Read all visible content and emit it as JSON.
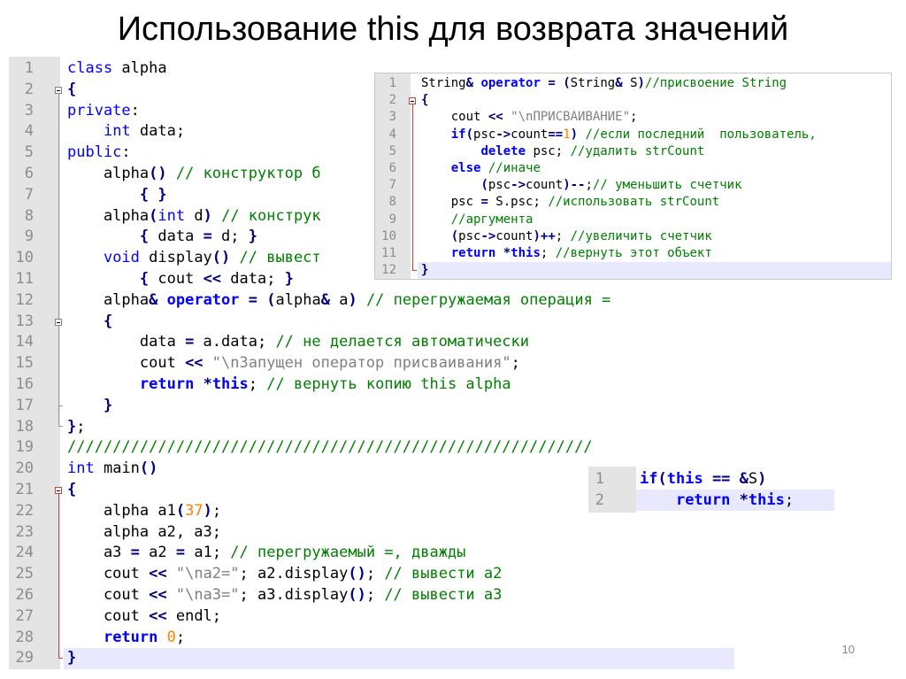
{
  "slide": {
    "title": "Использование this для возврата значений",
    "page_number": "10"
  },
  "colors": {
    "keyword": "#0000ff",
    "comment": "#008000",
    "string": "#808080",
    "number": "#ff8000",
    "gutter": "#e4e4e4",
    "current_line": "#e8e8ff"
  },
  "main_code": {
    "lines": [
      {
        "n": "1",
        "t": [
          [
            "kw",
            "class"
          ],
          [
            "pl",
            " alpha"
          ]
        ]
      },
      {
        "n": "2",
        "t": [
          [
            "op",
            "{"
          ]
        ]
      },
      {
        "n": "3",
        "t": [
          [
            "kw",
            "private"
          ],
          [
            "pl",
            ":"
          ]
        ]
      },
      {
        "n": "4",
        "t": [
          [
            "pl",
            "    "
          ],
          [
            "kw",
            "int"
          ],
          [
            "pl",
            " data;"
          ]
        ]
      },
      {
        "n": "5",
        "t": [
          [
            "kw",
            "public"
          ],
          [
            "pl",
            ":"
          ]
        ]
      },
      {
        "n": "6",
        "t": [
          [
            "pl",
            "    alpha"
          ],
          [
            "op",
            "()"
          ],
          [
            "pl",
            " "
          ],
          [
            "cm",
            "// конструктор б"
          ]
        ]
      },
      {
        "n": "7",
        "t": [
          [
            "pl",
            "        "
          ],
          [
            "op",
            "{"
          ],
          [
            "pl",
            " "
          ],
          [
            "op",
            "}"
          ]
        ]
      },
      {
        "n": "8",
        "t": [
          [
            "pl",
            "    alpha"
          ],
          [
            "op",
            "("
          ],
          [
            "kw",
            "int"
          ],
          [
            "pl",
            " d"
          ],
          [
            "op",
            ")"
          ],
          [
            "pl",
            " "
          ],
          [
            "cm",
            "// конструк"
          ]
        ]
      },
      {
        "n": "9",
        "t": [
          [
            "pl",
            "        "
          ],
          [
            "op",
            "{"
          ],
          [
            "pl",
            " data "
          ],
          [
            "op",
            "="
          ],
          [
            "pl",
            " d; "
          ],
          [
            "op",
            "}"
          ]
        ]
      },
      {
        "n": "10",
        "t": [
          [
            "pl",
            "    "
          ],
          [
            "kw",
            "void"
          ],
          [
            "pl",
            " display"
          ],
          [
            "op",
            "()"
          ],
          [
            "pl",
            " "
          ],
          [
            "cm",
            "// вывест"
          ]
        ]
      },
      {
        "n": "11",
        "t": [
          [
            "pl",
            "        "
          ],
          [
            "op",
            "{"
          ],
          [
            "pl",
            " cout "
          ],
          [
            "op",
            "<<"
          ],
          [
            "pl",
            " data; "
          ],
          [
            "op",
            "}"
          ]
        ]
      },
      {
        "n": "12",
        "t": [
          [
            "pl",
            "    alpha"
          ],
          [
            "op",
            "&"
          ],
          [
            "pl",
            " "
          ],
          [
            "kwb",
            "operator"
          ],
          [
            "pl",
            " "
          ],
          [
            "op",
            "="
          ],
          [
            "pl",
            " "
          ],
          [
            "op",
            "("
          ],
          [
            "pl",
            "alpha"
          ],
          [
            "op",
            "&"
          ],
          [
            "pl",
            " a"
          ],
          [
            "op",
            ")"
          ],
          [
            "pl",
            " "
          ],
          [
            "cm",
            "// перегружаемая операция ="
          ]
        ]
      },
      {
        "n": "13",
        "t": [
          [
            "pl",
            "    "
          ],
          [
            "op",
            "{"
          ]
        ]
      },
      {
        "n": "14",
        "t": [
          [
            "pl",
            "        data "
          ],
          [
            "op",
            "="
          ],
          [
            "pl",
            " a.data; "
          ],
          [
            "cm",
            "// не делается автоматически"
          ]
        ]
      },
      {
        "n": "15",
        "t": [
          [
            "pl",
            "        cout "
          ],
          [
            "op",
            "<<"
          ],
          [
            "pl",
            " "
          ],
          [
            "str",
            "\"\\nЗапущен оператор присваивания\""
          ],
          [
            "pl",
            ";"
          ]
        ]
      },
      {
        "n": "16",
        "t": [
          [
            "pl",
            "        "
          ],
          [
            "kwb",
            "return"
          ],
          [
            "pl",
            " "
          ],
          [
            "op",
            "*"
          ],
          [
            "kwb",
            "this"
          ],
          [
            "pl",
            "; "
          ],
          [
            "cm",
            "// вернуть копию this alpha"
          ]
        ]
      },
      {
        "n": "17",
        "t": [
          [
            "pl",
            "    "
          ],
          [
            "op",
            "}"
          ]
        ]
      },
      {
        "n": "18",
        "t": [
          [
            "op",
            "}"
          ],
          [
            "pl",
            ";"
          ]
        ]
      },
      {
        "n": "19",
        "t": [
          [
            "cm",
            "//////////////////////////////////////////////////////////"
          ]
        ]
      },
      {
        "n": "20",
        "t": [
          [
            "kw",
            "int"
          ],
          [
            "pl",
            " main"
          ],
          [
            "op",
            "()"
          ]
        ]
      },
      {
        "n": "21",
        "t": [
          [
            "op",
            "{"
          ]
        ]
      },
      {
        "n": "22",
        "t": [
          [
            "pl",
            "    alpha a1"
          ],
          [
            "op",
            "("
          ],
          [
            "num",
            "37"
          ],
          [
            "op",
            ")"
          ],
          [
            "pl",
            ";"
          ]
        ]
      },
      {
        "n": "23",
        "t": [
          [
            "pl",
            "    alpha a2, a3;"
          ]
        ]
      },
      {
        "n": "24",
        "t": [
          [
            "pl",
            "    a3 "
          ],
          [
            "op",
            "="
          ],
          [
            "pl",
            " a2 "
          ],
          [
            "op",
            "="
          ],
          [
            "pl",
            " a1; "
          ],
          [
            "cm",
            "// перегружаемый =, дважды"
          ]
        ]
      },
      {
        "n": "25",
        "t": [
          [
            "pl",
            "    cout "
          ],
          [
            "op",
            "<<"
          ],
          [
            "pl",
            " "
          ],
          [
            "str",
            "\"\\na2=\""
          ],
          [
            "pl",
            "; a2.display"
          ],
          [
            "op",
            "()"
          ],
          [
            "pl",
            "; "
          ],
          [
            "cm",
            "// вывести a2"
          ]
        ]
      },
      {
        "n": "26",
        "t": [
          [
            "pl",
            "    cout "
          ],
          [
            "op",
            "<<"
          ],
          [
            "pl",
            " "
          ],
          [
            "str",
            "\"\\na3=\""
          ],
          [
            "pl",
            "; a3.display"
          ],
          [
            "op",
            "()"
          ],
          [
            "pl",
            "; "
          ],
          [
            "cm",
            "// вывести a3"
          ]
        ]
      },
      {
        "n": "27",
        "t": [
          [
            "pl",
            "    cout "
          ],
          [
            "op",
            "<<"
          ],
          [
            "pl",
            " endl;"
          ]
        ]
      },
      {
        "n": "28",
        "t": [
          [
            "pl",
            "    "
          ],
          [
            "kwb",
            "return"
          ],
          [
            "pl",
            " "
          ],
          [
            "num",
            "0"
          ],
          [
            "pl",
            ";"
          ]
        ]
      },
      {
        "n": "29",
        "t": [
          [
            "op",
            "}"
          ]
        ]
      }
    ]
  },
  "inset_code": {
    "lines": [
      {
        "n": "1",
        "t": [
          [
            "pl",
            "String"
          ],
          [
            "op",
            "&"
          ],
          [
            "pl",
            " "
          ],
          [
            "kwb",
            "operator"
          ],
          [
            "pl",
            " "
          ],
          [
            "op",
            "="
          ],
          [
            "pl",
            " "
          ],
          [
            "op",
            "("
          ],
          [
            "pl",
            "String"
          ],
          [
            "op",
            "&"
          ],
          [
            "pl",
            " S"
          ],
          [
            "op",
            ")"
          ],
          [
            "cm",
            "//присвоение String"
          ]
        ]
      },
      {
        "n": "2",
        "t": [
          [
            "op",
            "{"
          ]
        ]
      },
      {
        "n": "3",
        "t": [
          [
            "pl",
            "    cout "
          ],
          [
            "op",
            "<<"
          ],
          [
            "pl",
            " "
          ],
          [
            "str",
            "\"\\nПРИСВАИВАНИЕ\""
          ],
          [
            "pl",
            ";"
          ]
        ]
      },
      {
        "n": "4",
        "t": [
          [
            "pl",
            "    "
          ],
          [
            "kwb",
            "if"
          ],
          [
            "op",
            "("
          ],
          [
            "pl",
            "psc"
          ],
          [
            "op",
            "->"
          ],
          [
            "pl",
            "count"
          ],
          [
            "op",
            "=="
          ],
          [
            "num",
            "1"
          ],
          [
            "op",
            ")"
          ],
          [
            "pl",
            " "
          ],
          [
            "cm",
            "//если последний  пользователь,"
          ]
        ]
      },
      {
        "n": "5",
        "t": [
          [
            "pl",
            "        "
          ],
          [
            "kwb",
            "delete"
          ],
          [
            "pl",
            " psc; "
          ],
          [
            "cm",
            "//удалить strCount"
          ]
        ]
      },
      {
        "n": "6",
        "t": [
          [
            "pl",
            "    "
          ],
          [
            "kwb",
            "else"
          ],
          [
            "pl",
            " "
          ],
          [
            "cm",
            "//иначе"
          ]
        ]
      },
      {
        "n": "7",
        "t": [
          [
            "pl",
            "        "
          ],
          [
            "op",
            "("
          ],
          [
            "pl",
            "psc"
          ],
          [
            "op",
            "->"
          ],
          [
            "pl",
            "count"
          ],
          [
            "op",
            ")--"
          ],
          [
            "pl",
            ";"
          ],
          [
            "cm",
            "// уменьшить счетчик"
          ]
        ]
      },
      {
        "n": "8",
        "t": [
          [
            "pl",
            "    psc "
          ],
          [
            "op",
            "="
          ],
          [
            "pl",
            " S.psc; "
          ],
          [
            "cm",
            "//использовать strCount"
          ]
        ]
      },
      {
        "n": "9",
        "t": [
          [
            "pl",
            "    "
          ],
          [
            "cm",
            "//аргумента"
          ]
        ]
      },
      {
        "n": "10",
        "t": [
          [
            "pl",
            "    "
          ],
          [
            "op",
            "("
          ],
          [
            "pl",
            "psc"
          ],
          [
            "op",
            "->"
          ],
          [
            "pl",
            "count"
          ],
          [
            "op",
            ")++"
          ],
          [
            "pl",
            "; "
          ],
          [
            "cm",
            "//увеличить счетчик"
          ]
        ]
      },
      {
        "n": "11",
        "t": [
          [
            "pl",
            "    "
          ],
          [
            "kwb",
            "return"
          ],
          [
            "pl",
            " "
          ],
          [
            "op",
            "*"
          ],
          [
            "kwb",
            "this"
          ],
          [
            "pl",
            "; "
          ],
          [
            "cm",
            "//вернуть этот объект"
          ]
        ]
      },
      {
        "n": "12",
        "t": [
          [
            "op",
            "}"
          ]
        ]
      }
    ]
  },
  "if_code": {
    "lines": [
      {
        "n": "1",
        "t": [
          [
            "kwb",
            "if"
          ],
          [
            "op",
            "("
          ],
          [
            "kwb",
            "this"
          ],
          [
            "pl",
            " "
          ],
          [
            "op",
            "=="
          ],
          [
            "pl",
            " "
          ],
          [
            "op",
            "&"
          ],
          [
            "pl",
            "S"
          ],
          [
            "op",
            ")"
          ]
        ]
      },
      {
        "n": "2",
        "t": [
          [
            "pl",
            "    "
          ],
          [
            "kwb",
            "return"
          ],
          [
            "pl",
            " "
          ],
          [
            "op",
            "*"
          ],
          [
            "kwb",
            "this"
          ],
          [
            "pl",
            ";"
          ]
        ]
      }
    ]
  }
}
